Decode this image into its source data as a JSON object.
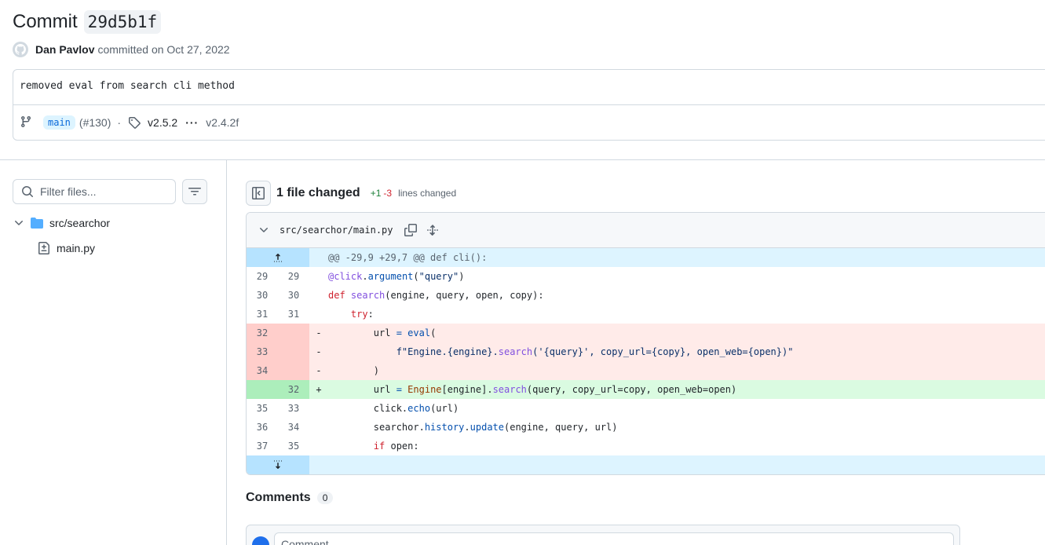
{
  "commit": {
    "title_prefix": "Commit",
    "sha": "29d5b1f",
    "author": "Dan Pavlov",
    "committed_text": "committed on Oct 27, 2022",
    "message": "removed eval from search cli method",
    "branch": "main",
    "pr_ref": "(#130)",
    "separator": "·",
    "tag": "v2.5.2",
    "ellipsis": "···",
    "tag_range_end": "v2.4.2f"
  },
  "sidebar": {
    "filter_placeholder": "Filter files...",
    "tree": {
      "folder": "src/searchor",
      "file": "main.py"
    }
  },
  "changes": {
    "summary": "1 file changed",
    "additions": "+1",
    "deletions": "-3",
    "lines_changed": "lines changed"
  },
  "file": {
    "path": "src/searchor/main.py",
    "hunk_header": "@@ -29,9 +29,7 @@ def cli():",
    "lines": [
      {
        "type": "ctx",
        "old": "29",
        "new": "29",
        "sign": "",
        "code": "@click.argument(\"query\")"
      },
      {
        "type": "ctx",
        "old": "30",
        "new": "30",
        "sign": "",
        "code": "def search(engine, query, open, copy):"
      },
      {
        "type": "ctx",
        "old": "31",
        "new": "31",
        "sign": "",
        "code": "    try:"
      },
      {
        "type": "del",
        "old": "32",
        "new": "",
        "sign": "-",
        "code": "        url = eval("
      },
      {
        "type": "del",
        "old": "33",
        "new": "",
        "sign": "-",
        "code": "            f\"Engine.{engine}.search('{query}', copy_url={copy}, open_web={open})\""
      },
      {
        "type": "del",
        "old": "34",
        "new": "",
        "sign": "-",
        "code": "        )"
      },
      {
        "type": "add",
        "old": "",
        "new": "32",
        "sign": "+",
        "code": "        url = Engine[engine].search(query, copy_url=copy, open_web=open)"
      },
      {
        "type": "ctx",
        "old": "35",
        "new": "33",
        "sign": "",
        "code": "        click.echo(url)"
      },
      {
        "type": "ctx",
        "old": "36",
        "new": "34",
        "sign": "",
        "code": "        searchor.history.update(engine, query, url)"
      },
      {
        "type": "ctx",
        "old": "37",
        "new": "35",
        "sign": "",
        "code": "        if open:"
      }
    ]
  },
  "comments": {
    "title": "Comments",
    "count": "0",
    "placeholder": "Comment"
  }
}
